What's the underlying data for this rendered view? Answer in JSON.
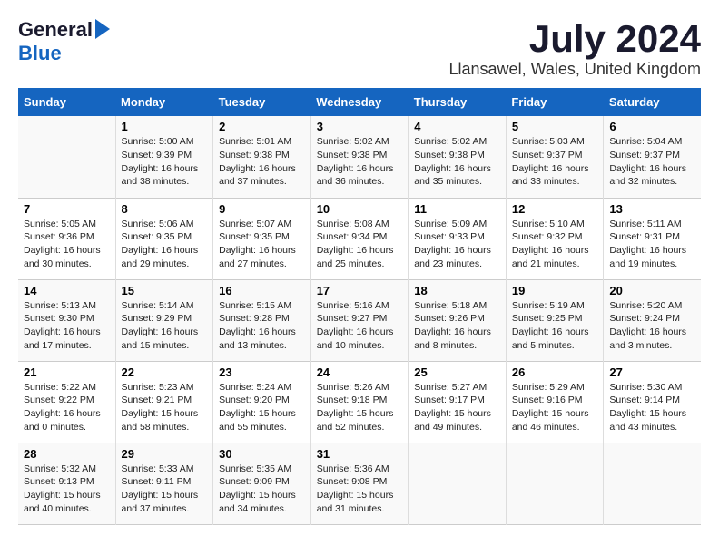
{
  "logo": {
    "general": "General",
    "blue": "Blue"
  },
  "title": "July 2024",
  "location": "Llansawel, Wales, United Kingdom",
  "days_of_week": [
    "Sunday",
    "Monday",
    "Tuesday",
    "Wednesday",
    "Thursday",
    "Friday",
    "Saturday"
  ],
  "weeks": [
    [
      {
        "day": "",
        "info": ""
      },
      {
        "day": "1",
        "info": "Sunrise: 5:00 AM\nSunset: 9:39 PM\nDaylight: 16 hours\nand 38 minutes."
      },
      {
        "day": "2",
        "info": "Sunrise: 5:01 AM\nSunset: 9:38 PM\nDaylight: 16 hours\nand 37 minutes."
      },
      {
        "day": "3",
        "info": "Sunrise: 5:02 AM\nSunset: 9:38 PM\nDaylight: 16 hours\nand 36 minutes."
      },
      {
        "day": "4",
        "info": "Sunrise: 5:02 AM\nSunset: 9:38 PM\nDaylight: 16 hours\nand 35 minutes."
      },
      {
        "day": "5",
        "info": "Sunrise: 5:03 AM\nSunset: 9:37 PM\nDaylight: 16 hours\nand 33 minutes."
      },
      {
        "day": "6",
        "info": "Sunrise: 5:04 AM\nSunset: 9:37 PM\nDaylight: 16 hours\nand 32 minutes."
      }
    ],
    [
      {
        "day": "7",
        "info": "Sunrise: 5:05 AM\nSunset: 9:36 PM\nDaylight: 16 hours\nand 30 minutes."
      },
      {
        "day": "8",
        "info": "Sunrise: 5:06 AM\nSunset: 9:35 PM\nDaylight: 16 hours\nand 29 minutes."
      },
      {
        "day": "9",
        "info": "Sunrise: 5:07 AM\nSunset: 9:35 PM\nDaylight: 16 hours\nand 27 minutes."
      },
      {
        "day": "10",
        "info": "Sunrise: 5:08 AM\nSunset: 9:34 PM\nDaylight: 16 hours\nand 25 minutes."
      },
      {
        "day": "11",
        "info": "Sunrise: 5:09 AM\nSunset: 9:33 PM\nDaylight: 16 hours\nand 23 minutes."
      },
      {
        "day": "12",
        "info": "Sunrise: 5:10 AM\nSunset: 9:32 PM\nDaylight: 16 hours\nand 21 minutes."
      },
      {
        "day": "13",
        "info": "Sunrise: 5:11 AM\nSunset: 9:31 PM\nDaylight: 16 hours\nand 19 minutes."
      }
    ],
    [
      {
        "day": "14",
        "info": "Sunrise: 5:13 AM\nSunset: 9:30 PM\nDaylight: 16 hours\nand 17 minutes."
      },
      {
        "day": "15",
        "info": "Sunrise: 5:14 AM\nSunset: 9:29 PM\nDaylight: 16 hours\nand 15 minutes."
      },
      {
        "day": "16",
        "info": "Sunrise: 5:15 AM\nSunset: 9:28 PM\nDaylight: 16 hours\nand 13 minutes."
      },
      {
        "day": "17",
        "info": "Sunrise: 5:16 AM\nSunset: 9:27 PM\nDaylight: 16 hours\nand 10 minutes."
      },
      {
        "day": "18",
        "info": "Sunrise: 5:18 AM\nSunset: 9:26 PM\nDaylight: 16 hours\nand 8 minutes."
      },
      {
        "day": "19",
        "info": "Sunrise: 5:19 AM\nSunset: 9:25 PM\nDaylight: 16 hours\nand 5 minutes."
      },
      {
        "day": "20",
        "info": "Sunrise: 5:20 AM\nSunset: 9:24 PM\nDaylight: 16 hours\nand 3 minutes."
      }
    ],
    [
      {
        "day": "21",
        "info": "Sunrise: 5:22 AM\nSunset: 9:22 PM\nDaylight: 16 hours\nand 0 minutes."
      },
      {
        "day": "22",
        "info": "Sunrise: 5:23 AM\nSunset: 9:21 PM\nDaylight: 15 hours\nand 58 minutes."
      },
      {
        "day": "23",
        "info": "Sunrise: 5:24 AM\nSunset: 9:20 PM\nDaylight: 15 hours\nand 55 minutes."
      },
      {
        "day": "24",
        "info": "Sunrise: 5:26 AM\nSunset: 9:18 PM\nDaylight: 15 hours\nand 52 minutes."
      },
      {
        "day": "25",
        "info": "Sunrise: 5:27 AM\nSunset: 9:17 PM\nDaylight: 15 hours\nand 49 minutes."
      },
      {
        "day": "26",
        "info": "Sunrise: 5:29 AM\nSunset: 9:16 PM\nDaylight: 15 hours\nand 46 minutes."
      },
      {
        "day": "27",
        "info": "Sunrise: 5:30 AM\nSunset: 9:14 PM\nDaylight: 15 hours\nand 43 minutes."
      }
    ],
    [
      {
        "day": "28",
        "info": "Sunrise: 5:32 AM\nSunset: 9:13 PM\nDaylight: 15 hours\nand 40 minutes."
      },
      {
        "day": "29",
        "info": "Sunrise: 5:33 AM\nSunset: 9:11 PM\nDaylight: 15 hours\nand 37 minutes."
      },
      {
        "day": "30",
        "info": "Sunrise: 5:35 AM\nSunset: 9:09 PM\nDaylight: 15 hours\nand 34 minutes."
      },
      {
        "day": "31",
        "info": "Sunrise: 5:36 AM\nSunset: 9:08 PM\nDaylight: 15 hours\nand 31 minutes."
      },
      {
        "day": "",
        "info": ""
      },
      {
        "day": "",
        "info": ""
      },
      {
        "day": "",
        "info": ""
      }
    ]
  ]
}
